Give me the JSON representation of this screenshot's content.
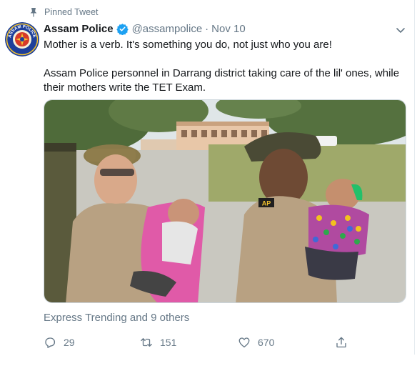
{
  "pinned_label": "Pinned Tweet",
  "author": {
    "name": "Assam Police",
    "handle": "@assampolice",
    "separator": "·",
    "date": "Nov 10",
    "avatar_text": "ASSAM POLICE"
  },
  "tweet": {
    "line1": "Mother is a verb. It's something you do, not just who you are!",
    "line2": "Assam Police personnel in Darrang district taking care of the lil' ones, while their mothers write the TET Exam."
  },
  "photo": {
    "badge_text": "AP"
  },
  "attribution": "Express Trending and 9 others",
  "actions": {
    "replies": "29",
    "retweets": "151",
    "likes": "670"
  },
  "colors": {
    "verified": "#1da1f2",
    "secondary_text": "#657786",
    "uniform": "#b8a182"
  }
}
